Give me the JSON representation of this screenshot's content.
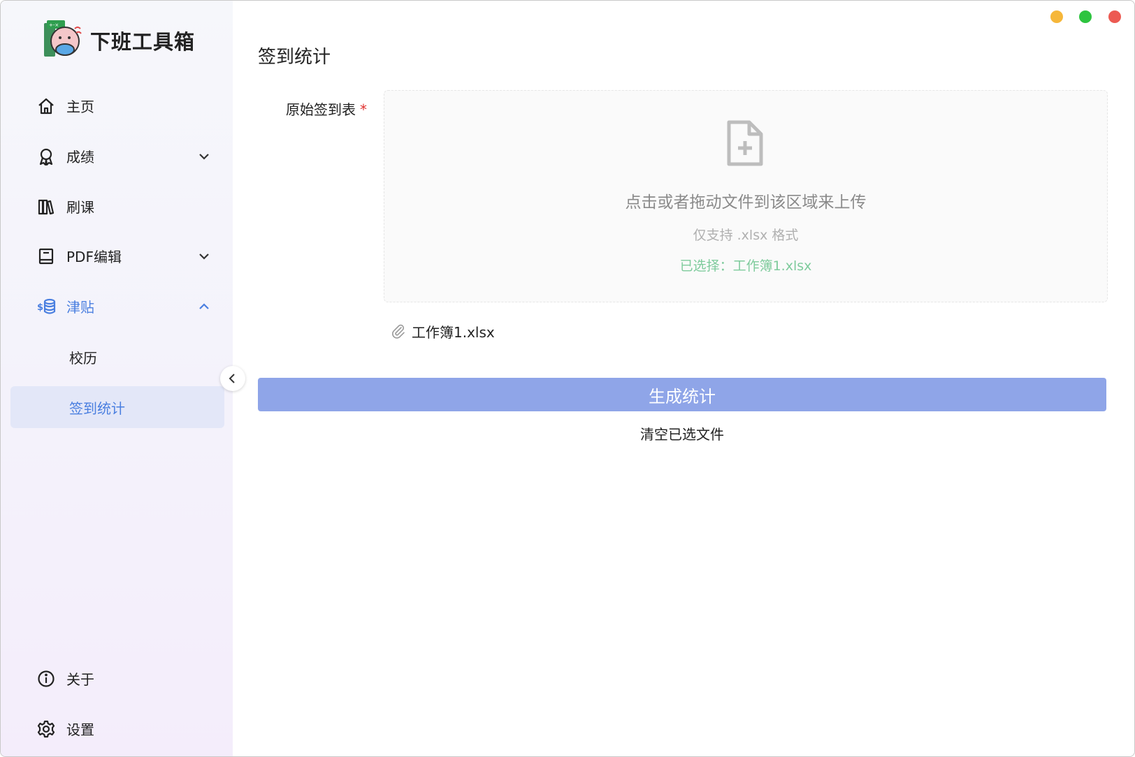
{
  "app": {
    "name": "下班工具箱"
  },
  "window_controls": {
    "minimize_color": "#f6b73a",
    "maximize_color": "#2dc43f",
    "close_color": "#ec5a52"
  },
  "sidebar": {
    "items": [
      {
        "label": "主页",
        "icon": "home-icon"
      },
      {
        "label": "成绩",
        "icon": "award-icon",
        "expand": "chevron-down"
      },
      {
        "label": "刷课",
        "icon": "books-icon"
      },
      {
        "label": "PDF编辑",
        "icon": "book-icon",
        "expand": "chevron-down"
      },
      {
        "label": "津贴",
        "icon": "coins-icon",
        "expand": "chevron-up"
      },
      {
        "label": "校历"
      },
      {
        "label": "签到统计"
      }
    ],
    "bottom": [
      {
        "label": "关于",
        "icon": "info-icon"
      },
      {
        "label": "设置",
        "icon": "gear-icon"
      }
    ]
  },
  "main": {
    "title": "签到统计",
    "field_label": "原始签到表",
    "required_mark": "*",
    "upload": {
      "main_text": "点击或者拖动文件到该区域来上传",
      "hint": "仅支持 .xlsx 格式",
      "selected": "已选择：工作簿1.xlsx"
    },
    "file_name": "工作簿1.xlsx",
    "generate_label": "生成统计",
    "clear_label": "清空已选文件"
  },
  "colors": {
    "accent": "#4a7fe0",
    "primary_button": "#8fa5e8",
    "success_text": "#7ecb9c",
    "required": "#e0312f"
  }
}
